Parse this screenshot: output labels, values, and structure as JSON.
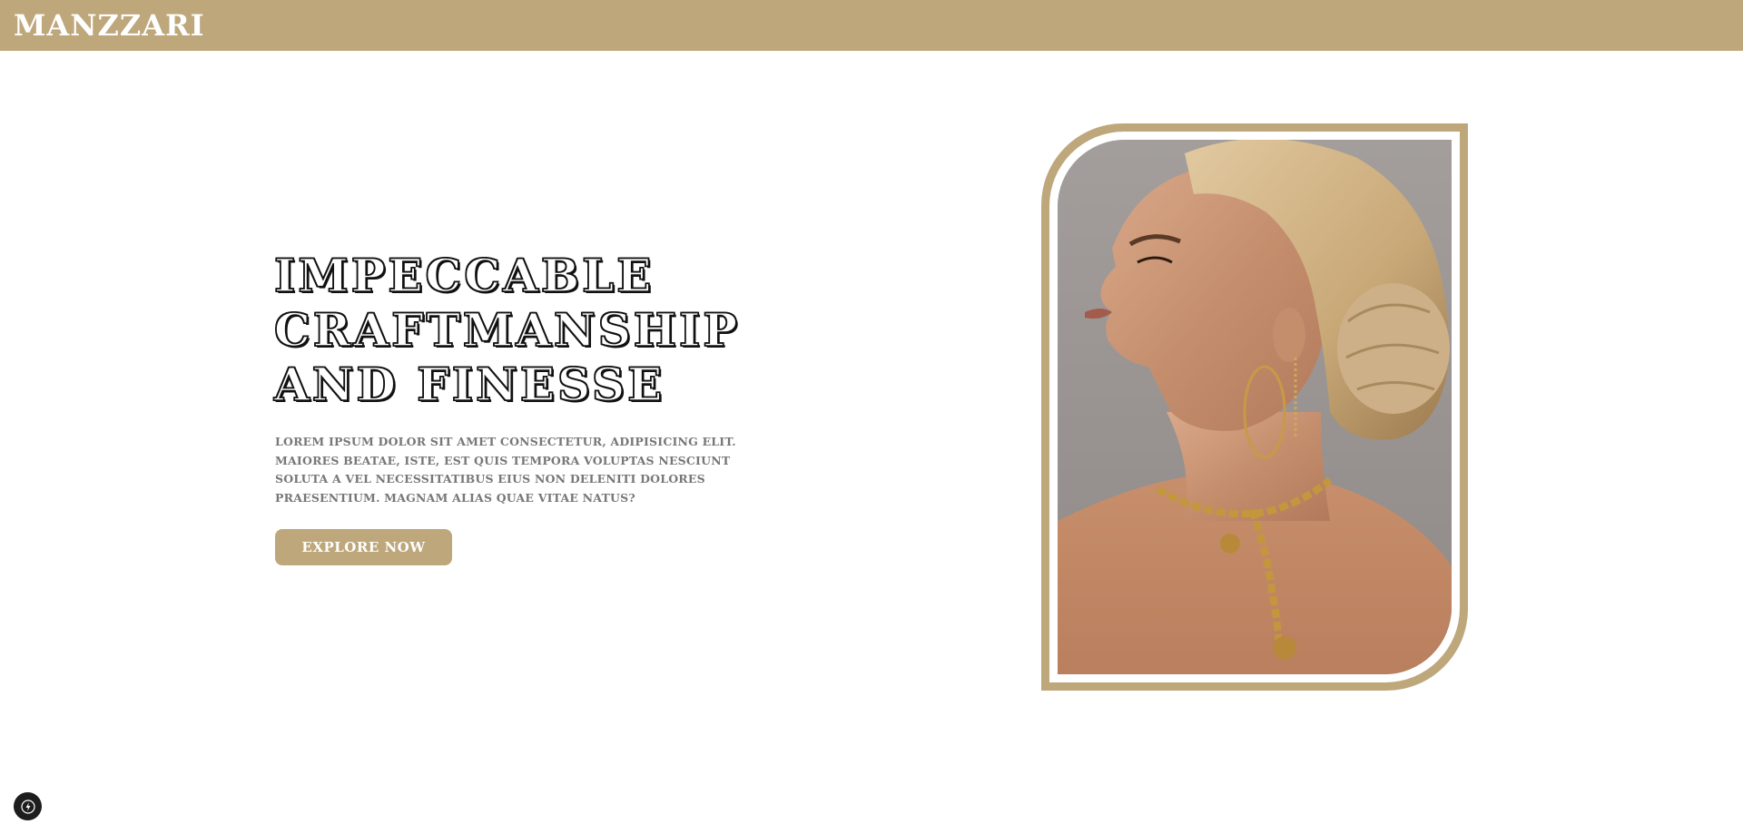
{
  "header": {
    "brand": "MANZZARI"
  },
  "hero": {
    "title": "IMPECCABLE CRAFTMANSHIP AND FINESSE",
    "description": "Lorem ipsum dolor sit amet consectetur, adipisicing elit. Maiores beatae, iste, est quis tempora voluptas nesciunt soluta a vel necessitatibus eius non deleniti dolores praesentium. Magnam alias quae vitae natus?",
    "cta_label": "EXPLORE NOW"
  },
  "icons": {
    "hero_image": "jewelry-model-photo",
    "corner_badge": "lightning-bolt-icon"
  },
  "colors": {
    "accent": "#bda77b",
    "title_text": "#111111",
    "body_text": "#777777",
    "background": "#ffffff"
  }
}
